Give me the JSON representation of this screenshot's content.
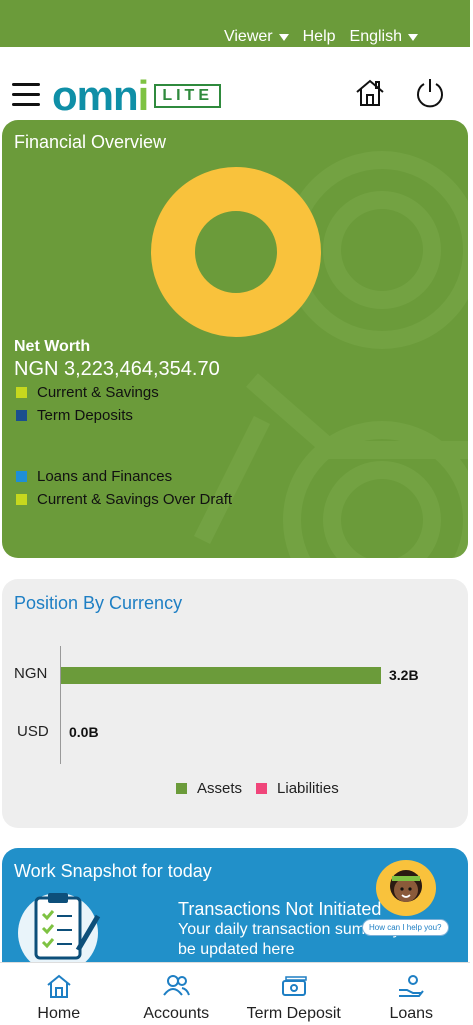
{
  "topbar": {
    "viewer_label": "Viewer",
    "help_label": "Help",
    "language_label": "English"
  },
  "header": {
    "logo_main": "omn",
    "logo_i": "i",
    "logo_lite": "LITE"
  },
  "financial_overview": {
    "title": "Financial Overview",
    "net_worth_label": "Net Worth",
    "net_worth_value": "NGN 3,223,464,354.70",
    "donut_color": "#f9c23c",
    "legend": [
      {
        "label": "Current & Savings",
        "color": "#c6d81e"
      },
      {
        "label": "Term Deposits",
        "color": "#1b4f8e"
      },
      {
        "label": "Loans and Finances",
        "color": "#1e8fd6"
      },
      {
        "label": "Current & Savings Over Draft",
        "color": "#c6d81e"
      }
    ]
  },
  "position_by_currency": {
    "title": "Position By Currency",
    "legend": [
      {
        "label": "Assets",
        "color": "#6b9b3a"
      },
      {
        "label": "Liabilities",
        "color": "#f0457a"
      }
    ]
  },
  "chart_data": {
    "type": "bar",
    "orientation": "horizontal",
    "categories": [
      "NGN",
      "USD"
    ],
    "series": [
      {
        "name": "Assets",
        "values": [
          3.2,
          0.0
        ]
      }
    ],
    "value_labels": [
      "3.2B",
      "0.0B"
    ],
    "xlim": [
      0,
      3.2
    ]
  },
  "work_snapshot": {
    "title": "Work Snapshot for today",
    "heading": "Transactions Not Initiated",
    "text": "Your daily transaction summary will be updated here",
    "assistant_prompt": "How can I help you?"
  },
  "bottom_nav": [
    {
      "label": "Home",
      "icon": "home-icon"
    },
    {
      "label": "Accounts",
      "icon": "users-icon"
    },
    {
      "label": "Term Deposit",
      "icon": "banknote-icon"
    },
    {
      "label": "Loans",
      "icon": "hand-coin-icon"
    }
  ]
}
